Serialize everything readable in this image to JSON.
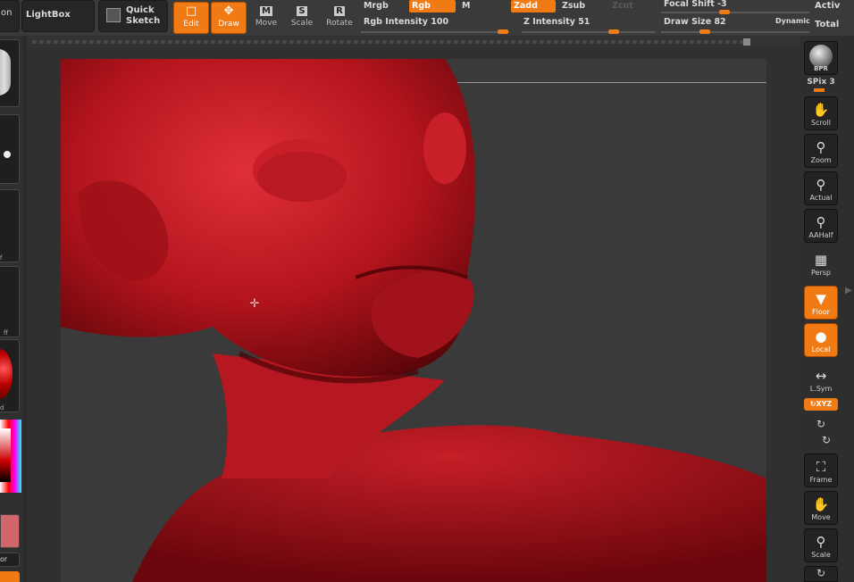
{
  "top_shelf": {
    "left_clip_label": "on",
    "lightbox_label": "LightBox",
    "quick_sketch_line1": "Quick",
    "quick_sketch_line2": "Sketch",
    "tools": [
      {
        "label": "Edit",
        "icon": "edit-icon",
        "active": true
      },
      {
        "label": "Draw",
        "icon": "draw-icon",
        "active": true
      },
      {
        "label": "Move",
        "icon": "move-icon",
        "key": "M",
        "active": false
      },
      {
        "label": "Scale",
        "icon": "scale-icon",
        "key": "S",
        "active": false
      },
      {
        "label": "Rotate",
        "icon": "rotate-icon",
        "key": "R",
        "active": false
      }
    ],
    "modes": {
      "mrgb": "Mrgb",
      "rgb": "Rgb",
      "m": "M",
      "zadd": "Zadd",
      "zsub": "Zsub",
      "zcut": "Zcut"
    },
    "sliders": {
      "rgb_intensity_label": "Rgb Intensity 100",
      "rgb_intensity_value": 100,
      "z_intensity_label": "Z Intensity 51",
      "z_intensity_value": 51,
      "focal_shift_label": "Focal Shift -3",
      "focal_shift_value": -3,
      "draw_size_label": "Draw Size 82",
      "draw_size_value": 82,
      "dynamic_label": "Dynamic"
    },
    "right_clip_top": "Activ",
    "right_clip_bottom": "Total"
  },
  "left_tray": {
    "clip_labels": [
      "f",
      "ff",
      "d",
      "or"
    ]
  },
  "right_tray": {
    "bpr_label": "BPR",
    "spix_label": "SPix 3",
    "buttons": [
      {
        "label": "Scroll",
        "icon": "scroll-hand-icon",
        "active": false
      },
      {
        "label": "Zoom",
        "icon": "zoom-icon",
        "active": false
      },
      {
        "label": "Actual",
        "icon": "actual-size-icon",
        "active": false
      },
      {
        "label": "AAHalf",
        "icon": "aahalf-icon",
        "active": false
      },
      {
        "label": "Persp",
        "icon": "perspective-icon",
        "active": false
      },
      {
        "label": "Floor",
        "icon": "floor-icon",
        "active": true
      },
      {
        "label": "Local",
        "icon": "local-transform-icon",
        "active": true
      },
      {
        "label": "L.Sym",
        "icon": "local-symmetry-icon",
        "active": false
      },
      {
        "label": "XYZ",
        "icon": "xyz-rotate-icon",
        "active": true
      },
      {
        "label": "Frame",
        "icon": "frame-icon",
        "active": false
      },
      {
        "label": "Move",
        "icon": "move-hand-icon",
        "active": false
      },
      {
        "label": "Scale",
        "icon": "scale-zoom-icon",
        "active": false
      }
    ]
  },
  "colors": {
    "accent": "#f07a14",
    "sculpt_red": "#b3141c"
  }
}
